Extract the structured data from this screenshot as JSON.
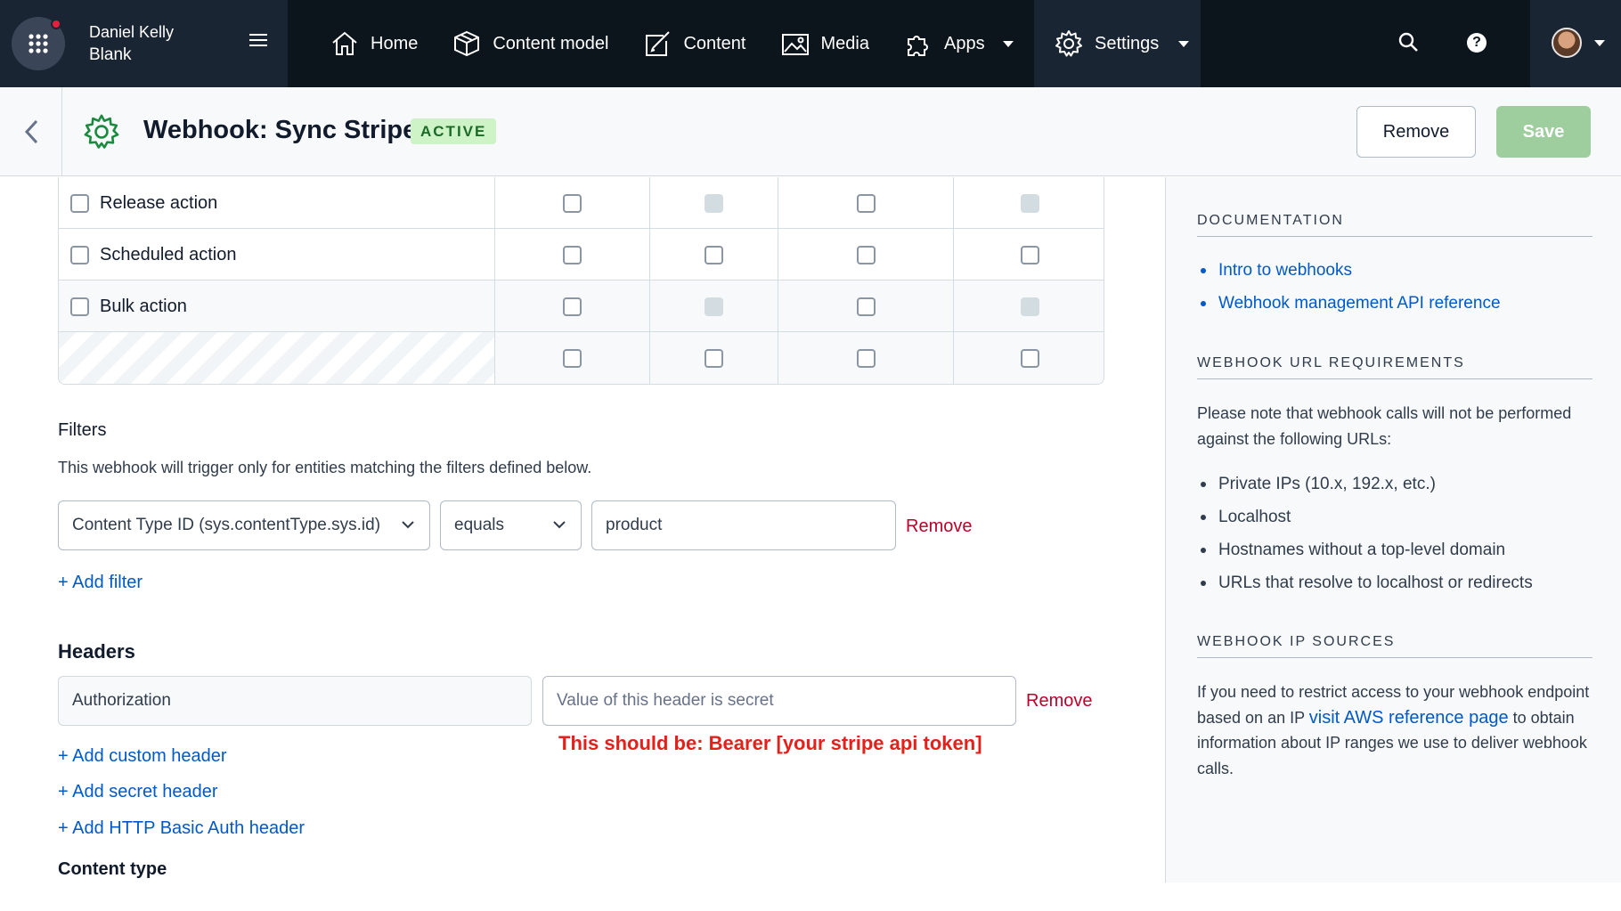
{
  "topnav": {
    "space_name": "Daniel Kelly",
    "environment": "Blank",
    "items": [
      {
        "label": "Home",
        "icon": "home-icon"
      },
      {
        "label": "Content model",
        "icon": "box-icon"
      },
      {
        "label": "Content",
        "icon": "edit-document-icon"
      },
      {
        "label": "Media",
        "icon": "image-icon"
      },
      {
        "label": "Apps",
        "icon": "puzzle-icon"
      }
    ],
    "settings_label": "Settings"
  },
  "header": {
    "title": "Webhook: Sync Stripe",
    "status": "ACTIVE",
    "remove_label": "Remove",
    "save_label": "Save"
  },
  "triggers": {
    "rows": [
      {
        "label": "Release action",
        "checks": [
          "on",
          "disabled",
          "on",
          "disabled"
        ]
      },
      {
        "label": "Scheduled action",
        "checks": [
          "on",
          "on",
          "on",
          "on"
        ]
      },
      {
        "label": "Bulk action",
        "checks": [
          "on",
          "disabled",
          "on",
          "disabled"
        ]
      },
      {
        "label": "",
        "checks": [
          "on",
          "on",
          "on",
          "on"
        ]
      }
    ]
  },
  "filters": {
    "title": "Filters",
    "description": "This webhook will trigger only for entities matching the filters defined below.",
    "field_value": "Content Type ID (sys.contentType.sys.id)",
    "operator_value": "equals",
    "value": "product",
    "remove_label": "Remove",
    "add_label": "+ Add filter"
  },
  "headers": {
    "title": "Headers",
    "key_value": "Authorization",
    "value_placeholder": "Value of this header is secret",
    "remove_label": "Remove",
    "annotation": "This should be: Bearer [your stripe api token]",
    "add_custom": "+ Add custom header",
    "add_secret": "+ Add secret header",
    "add_basic": "+ Add HTTP Basic Auth header"
  },
  "content_type": {
    "title": "Content type"
  },
  "sidebar": {
    "documentation": {
      "heading": "DOCUMENTATION",
      "links": [
        "Intro to webhooks",
        "Webhook management API reference"
      ]
    },
    "url_requirements": {
      "heading": "WEBHOOK URL REQUIREMENTS",
      "text": "Please note that webhook calls will not be performed against the following URLs:",
      "items": [
        "Private IPs (10.x, 192.x, etc.)",
        "Localhost",
        "Hostnames without a top-level domain",
        "URLs that resolve to localhost or redirects"
      ]
    },
    "ip_sources": {
      "heading": "WEBHOOK IP SOURCES",
      "text_before": "If you need to restrict access to your webhook endpoint based on an IP ",
      "link": "visit AWS reference page",
      "text_after": " to obtain information about IP ranges we use to deliver webhook calls."
    }
  },
  "colors": {
    "nav_bg": "#0c141c",
    "nav_block": "#1a2533",
    "link_blue": "#0059c8",
    "danger_red": "#bd002a",
    "annotation_red": "#e4201b",
    "save_green": "#9ecd9e",
    "badge_bg": "#cdf3c6"
  }
}
